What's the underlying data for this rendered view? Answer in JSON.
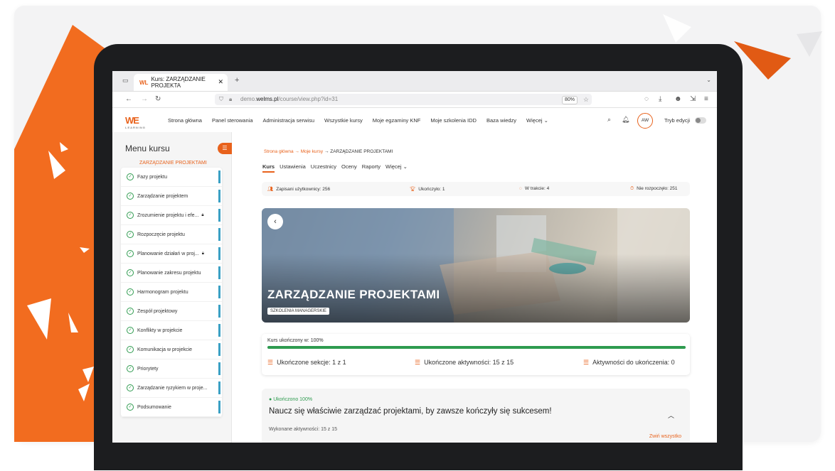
{
  "browser": {
    "tab_title": "Kurs: ZARZĄDZANIE PROJEKTA",
    "tab_favicon": "WL",
    "url_prefix": "demo.",
    "url_domain": "welms.pl",
    "url_path": "/course/view.php?id=31",
    "zoom": "80%"
  },
  "site": {
    "logo": "WE",
    "logo_sub": "LEARNING",
    "menu": [
      "Strona główna",
      "Panel sterowania",
      "Administracja serwisu",
      "Wszystkie kursy",
      "Moje egzaminy KNF",
      "Moje szkolenia IDD",
      "Baza wiedzy",
      "Więcej"
    ],
    "avatar": "AW",
    "edit_mode": "Tryb edycji"
  },
  "sidebar": {
    "title": "Menu kursu",
    "course": "ZARZĄDZANIE PROJEKTAMI",
    "items": [
      {
        "label": "Fazy projektu",
        "locked": false
      },
      {
        "label": "Zarządzanie projektem",
        "locked": false
      },
      {
        "label": "Zrozumienie projektu i efe...",
        "locked": true
      },
      {
        "label": "Rozpoczęcie projektu",
        "locked": false
      },
      {
        "label": "Planowanie działań w proj...",
        "locked": true
      },
      {
        "label": "Planowanie zakresu projektu",
        "locked": false
      },
      {
        "label": "Harmonogram projektu",
        "locked": false
      },
      {
        "label": "Zespół projektowy",
        "locked": false
      },
      {
        "label": "Konflikty w projekcie",
        "locked": false
      },
      {
        "label": "Komunikacja w projekcie",
        "locked": false
      },
      {
        "label": "Priorytety",
        "locked": false
      },
      {
        "label": "Zarządzanie ryzykiem w proje...",
        "locked": false
      },
      {
        "label": "Podsumowanie",
        "locked": false
      }
    ]
  },
  "breadcrumb": {
    "b1": "Strona główna",
    "b2": "Moje kursy",
    "b3": "ZARZĄDZANIE PROJEKTAMI",
    "sep": "→"
  },
  "course_nav": [
    "Kurs",
    "Ustawienia",
    "Uczestnicy",
    "Oceny",
    "Raporty",
    "Więcej"
  ],
  "stats": {
    "enrolled": "Zapisani użytkownicy: 256",
    "completed": "Ukończyło: 1",
    "in_progress": "W trakcie: 4",
    "not_started": "Nie rozpoczęło: 251"
  },
  "hero": {
    "title": "ZARZĄDZANIE PROJEKTAMI",
    "tag": "SZKOLENIA MANAGERSKIE"
  },
  "progress": {
    "label": "Kurs ukończony w: 100%",
    "percent": 100,
    "sections": "Ukończone sekcje: 1 z 1",
    "activities": "Ukończone aktywności: 15 z 15",
    "todo": "Aktywności do ukończenia: 0"
  },
  "section": {
    "status": "Ukończono 100%",
    "title": "Naucz się właściwie zarządzać projektami, by zawsze kończyły się sukcesem!",
    "activities": "Wykonane aktywności: 15 z 15",
    "collapse": "Zwiń wszystko"
  },
  "colors": {
    "accent": "#e8621c",
    "success": "#2e9b4f",
    "sidebar_bar": "#3aa0c4"
  }
}
